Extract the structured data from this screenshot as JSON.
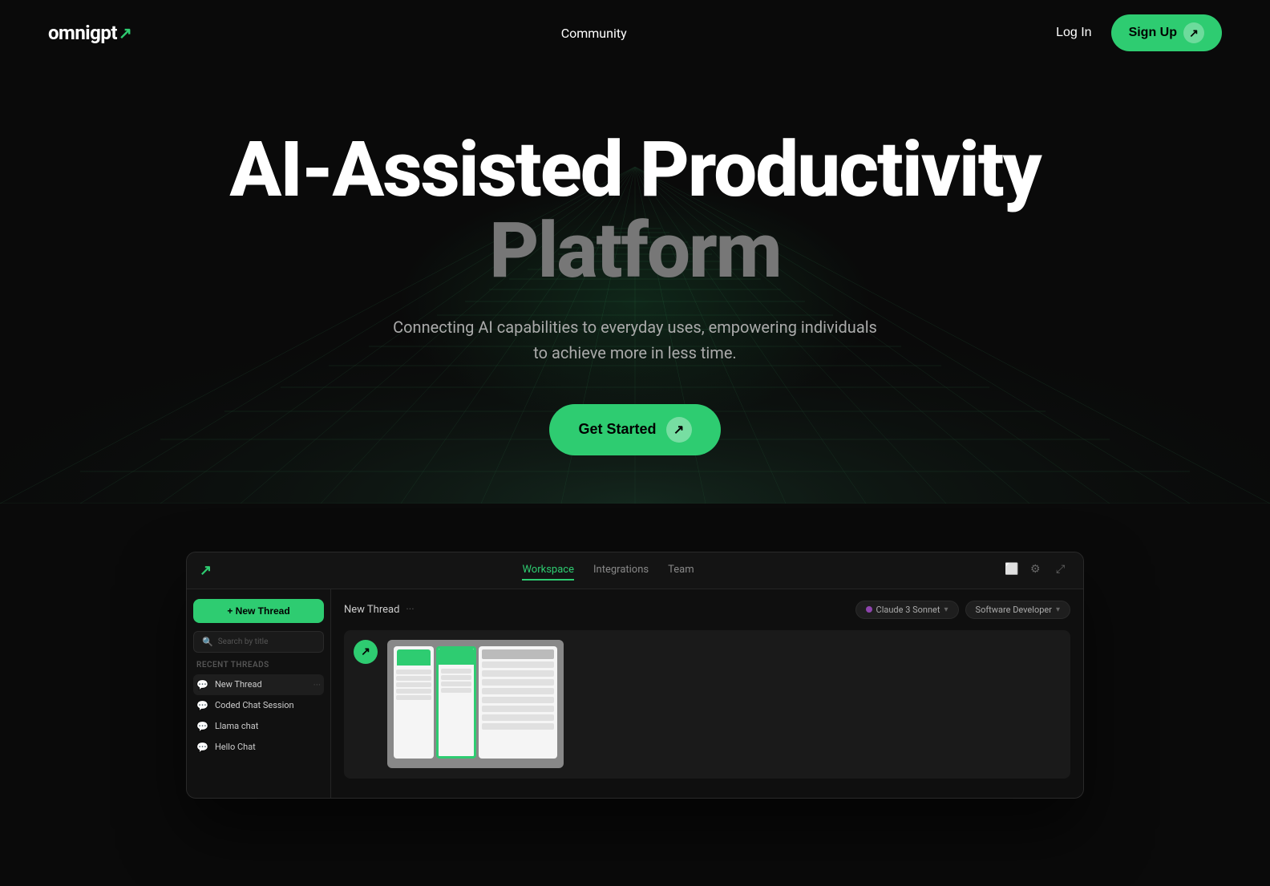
{
  "navbar": {
    "logo_text": "omnigpt",
    "logo_arrow": "↗",
    "nav_links": [
      {
        "label": "Community",
        "id": "community"
      }
    ],
    "login_label": "Log In",
    "signup_label": "Sign Up",
    "signup_arrow": "↗"
  },
  "hero": {
    "title_line1": "AI-Assisted Productivity",
    "title_line2": "Platform",
    "subtitle": "Connecting AI capabilities to everyday uses, empowering individuals to achieve more in less time.",
    "cta_label": "Get Started",
    "cta_arrow": "↗"
  },
  "app_preview": {
    "window_logo": "↗",
    "tabs": [
      {
        "label": "Workspace",
        "active": true
      },
      {
        "label": "Integrations",
        "active": false
      },
      {
        "label": "Team",
        "active": false
      }
    ],
    "sidebar": {
      "new_thread_label": "+ New Thread",
      "search_placeholder": "Search by title",
      "recent_threads_label": "Recent Threads",
      "threads": [
        {
          "label": "New Thread",
          "active": true
        },
        {
          "label": "Coded Chat Session",
          "active": false
        },
        {
          "label": "Llama chat",
          "active": false
        },
        {
          "label": "Hello Chat",
          "active": false
        }
      ]
    },
    "main": {
      "thread_title": "New Thread",
      "thread_dots": "···",
      "badge_model": "Claude 3 Sonnet",
      "badge_role": "Software Developer",
      "canvas_initial": "↗"
    },
    "action_icons": [
      "document-icon",
      "settings-icon",
      "expand-icon"
    ]
  },
  "colors": {
    "accent": "#2ecc71",
    "background": "#0a0a0a",
    "surface": "#111111",
    "border": "#252525"
  }
}
